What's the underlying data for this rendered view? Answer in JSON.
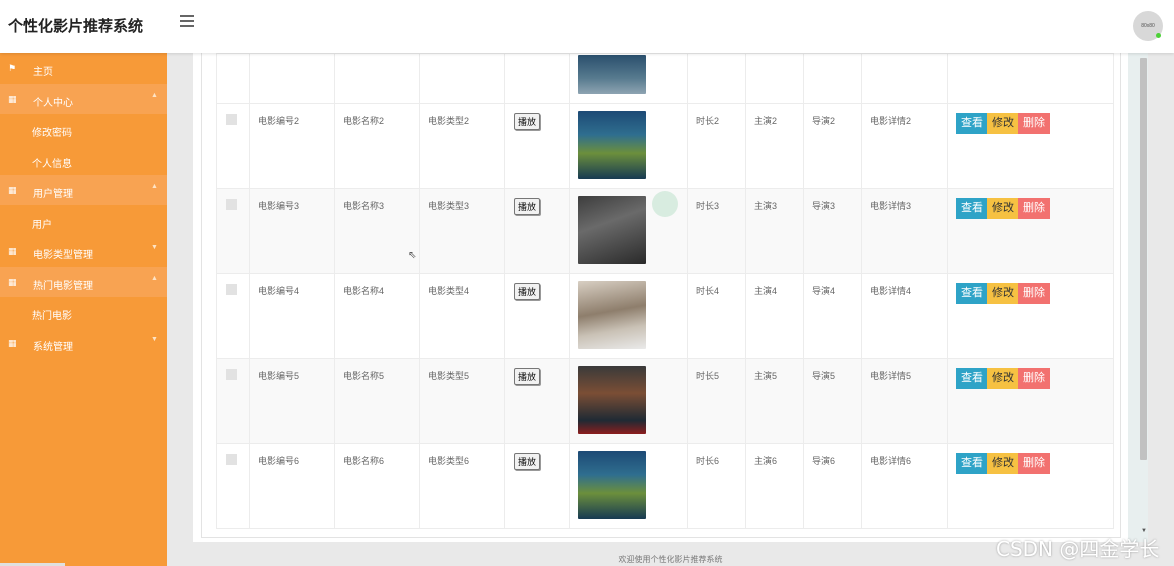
{
  "header": {
    "title": "个性化影片推荐系统",
    "avatar_text": "80x80"
  },
  "sidebar": {
    "items": [
      {
        "label": "主页",
        "icon": "flag-icon",
        "type": "main"
      },
      {
        "label": "个人中心",
        "icon": "grid-icon",
        "type": "group",
        "caret": "▲"
      },
      {
        "label": "修改密码",
        "type": "sub"
      },
      {
        "label": "个人信息",
        "type": "sub"
      },
      {
        "label": "用户管理",
        "icon": "grid-icon",
        "type": "group",
        "caret": "▲"
      },
      {
        "label": "用户",
        "type": "sub"
      },
      {
        "label": "电影类型管理",
        "icon": "grid-icon",
        "type": "main",
        "caret": "▼"
      },
      {
        "label": "热门电影管理",
        "icon": "grid-icon",
        "type": "group",
        "caret": "▲"
      },
      {
        "label": "热门电影",
        "type": "sub"
      },
      {
        "label": "系统管理",
        "icon": "grid-icon",
        "type": "main",
        "caret": "▼"
      }
    ]
  },
  "table": {
    "play_label": "播放",
    "actions": {
      "view": "查看",
      "edit": "修改",
      "delete": "删除"
    },
    "rows": [
      {
        "id": "电影编号2",
        "name": "电影名称2",
        "type": "电影类型2",
        "duration": "时长2",
        "star": "主演2",
        "director": "导演2",
        "detail": "电影详情2",
        "poster": "blue"
      },
      {
        "id": "电影编号3",
        "name": "电影名称3",
        "type": "电影类型3",
        "duration": "时长3",
        "star": "主演3",
        "director": "导演3",
        "detail": "电影详情3",
        "poster": "dark"
      },
      {
        "id": "电影编号4",
        "name": "电影名称4",
        "type": "电影类型4",
        "duration": "时长4",
        "star": "主演4",
        "director": "导演4",
        "detail": "电影详情4",
        "poster": "car"
      },
      {
        "id": "电影编号5",
        "name": "电影名称5",
        "type": "电影类型5",
        "duration": "时长5",
        "star": "主演5",
        "director": "导演5",
        "detail": "电影详情5",
        "poster": "jackie"
      },
      {
        "id": "电影编号6",
        "name": "电影名称6",
        "type": "电影类型6",
        "duration": "时长6",
        "star": "主演6",
        "director": "导演6",
        "detail": "电影详情6",
        "poster": "blue"
      }
    ]
  },
  "footer": {
    "text": "欢迎使用个性化影片推荐系统"
  },
  "watermark": "CSDN @四金学长"
}
